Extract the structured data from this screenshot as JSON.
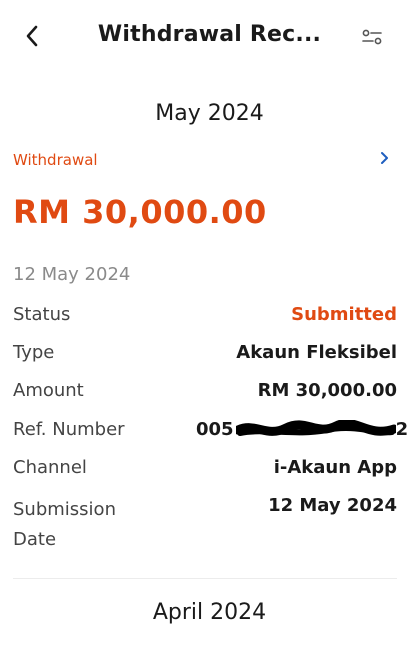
{
  "header": {
    "title": "Withdrawal Rec...",
    "back_icon": "chevron-left-icon",
    "filter_icon": "filter-sliders-icon"
  },
  "groups": [
    {
      "month": "May 2024",
      "record": {
        "type_label": "Withdrawal",
        "amount": "RM 30,000.00",
        "date": "12 May 2024",
        "details": {
          "status_label": "Status",
          "status_value": "Submitted",
          "type_label": "Type",
          "type_value": "Akaun Fleksibel",
          "amount_label": "Amount",
          "amount_value": "RM 30,000.00",
          "ref_label": "Ref. Number",
          "ref_prefix": "005",
          "ref_suffix": "2",
          "channel_label": "Channel",
          "channel_value": "i-Akaun App",
          "submission_label": "Submission Date",
          "submission_value": "12 May 2024"
        }
      }
    },
    {
      "month": "April 2024"
    }
  ],
  "colors": {
    "accent": "#e04a12",
    "link": "#1f5fbf",
    "muted": "#8a8a8a"
  }
}
